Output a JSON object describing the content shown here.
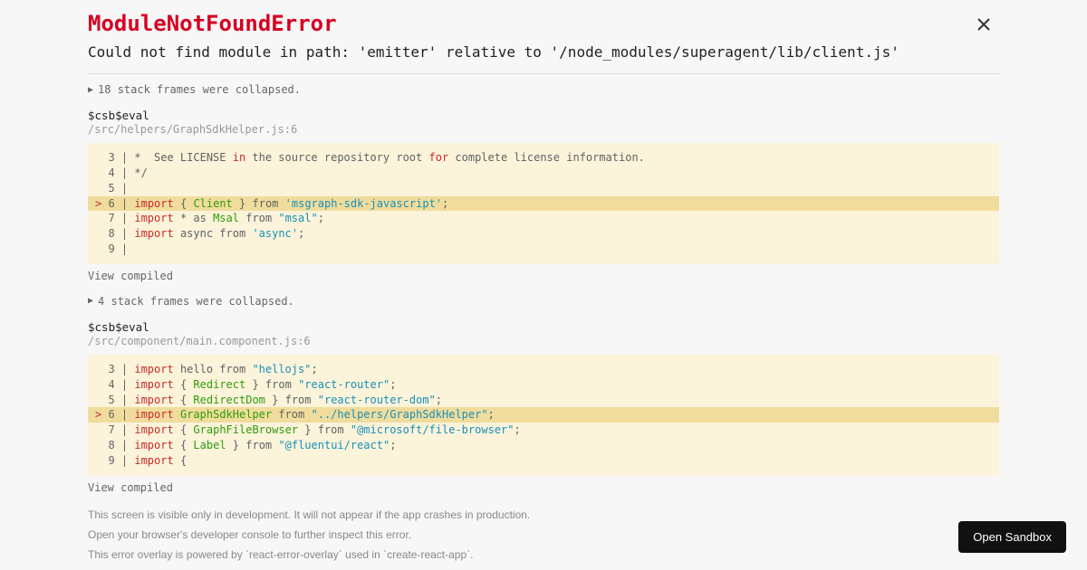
{
  "error": {
    "title": "ModuleNotFoundError",
    "message": "Could not find module in path: 'emitter' relative to '/node_modules/superagent/lib/client.js'"
  },
  "collapse1": "18 stack frames were collapsed.",
  "frame1": {
    "name": "$csb$eval",
    "path": "/src/helpers/GraphSdkHelper.js:6"
  },
  "viewCompiled": "View compiled",
  "collapse2": "4 stack frames were collapsed.",
  "frame2": {
    "name": "$csb$eval",
    "path": "/src/component/main.component.js:6"
  },
  "footer": {
    "line1": "This screen is visible only in development. It will not appear if the app crashes in production.",
    "line2": "Open your browser's developer console to further inspect this error.",
    "line3": "This error overlay is powered by `react-error-overlay` used in `create-react-app`."
  },
  "openSandbox": "Open Sandbox",
  "code1": {
    "l3": "  3 | *  See LICENSE in the source repository root for complete license information.",
    "l4": "  4 | */",
    "l5": "  5 | ",
    "l6": "> 6 | import { Client } from 'msgraph-sdk-javascript';",
    "l7": "  7 | import * as Msal from \"msal\";",
    "l8": "  8 | import async from 'async';",
    "l9": "  9 | "
  },
  "code2": {
    "l3": "  3 | import hello from \"hellojs\";",
    "l4": "  4 | import { Redirect } from \"react-router\";",
    "l5": "  5 | import { RedirectDom } from \"react-router-dom\";",
    "l6": "> 6 | import GraphSdkHelper from \"../helpers/GraphSdkHelper\";",
    "l7": "  7 | import { GraphFileBrowser } from \"@microsoft/file-browser\";",
    "l8": "  8 | import { Label } from \"@fluentui/react\";",
    "l9": "  9 | import {"
  }
}
